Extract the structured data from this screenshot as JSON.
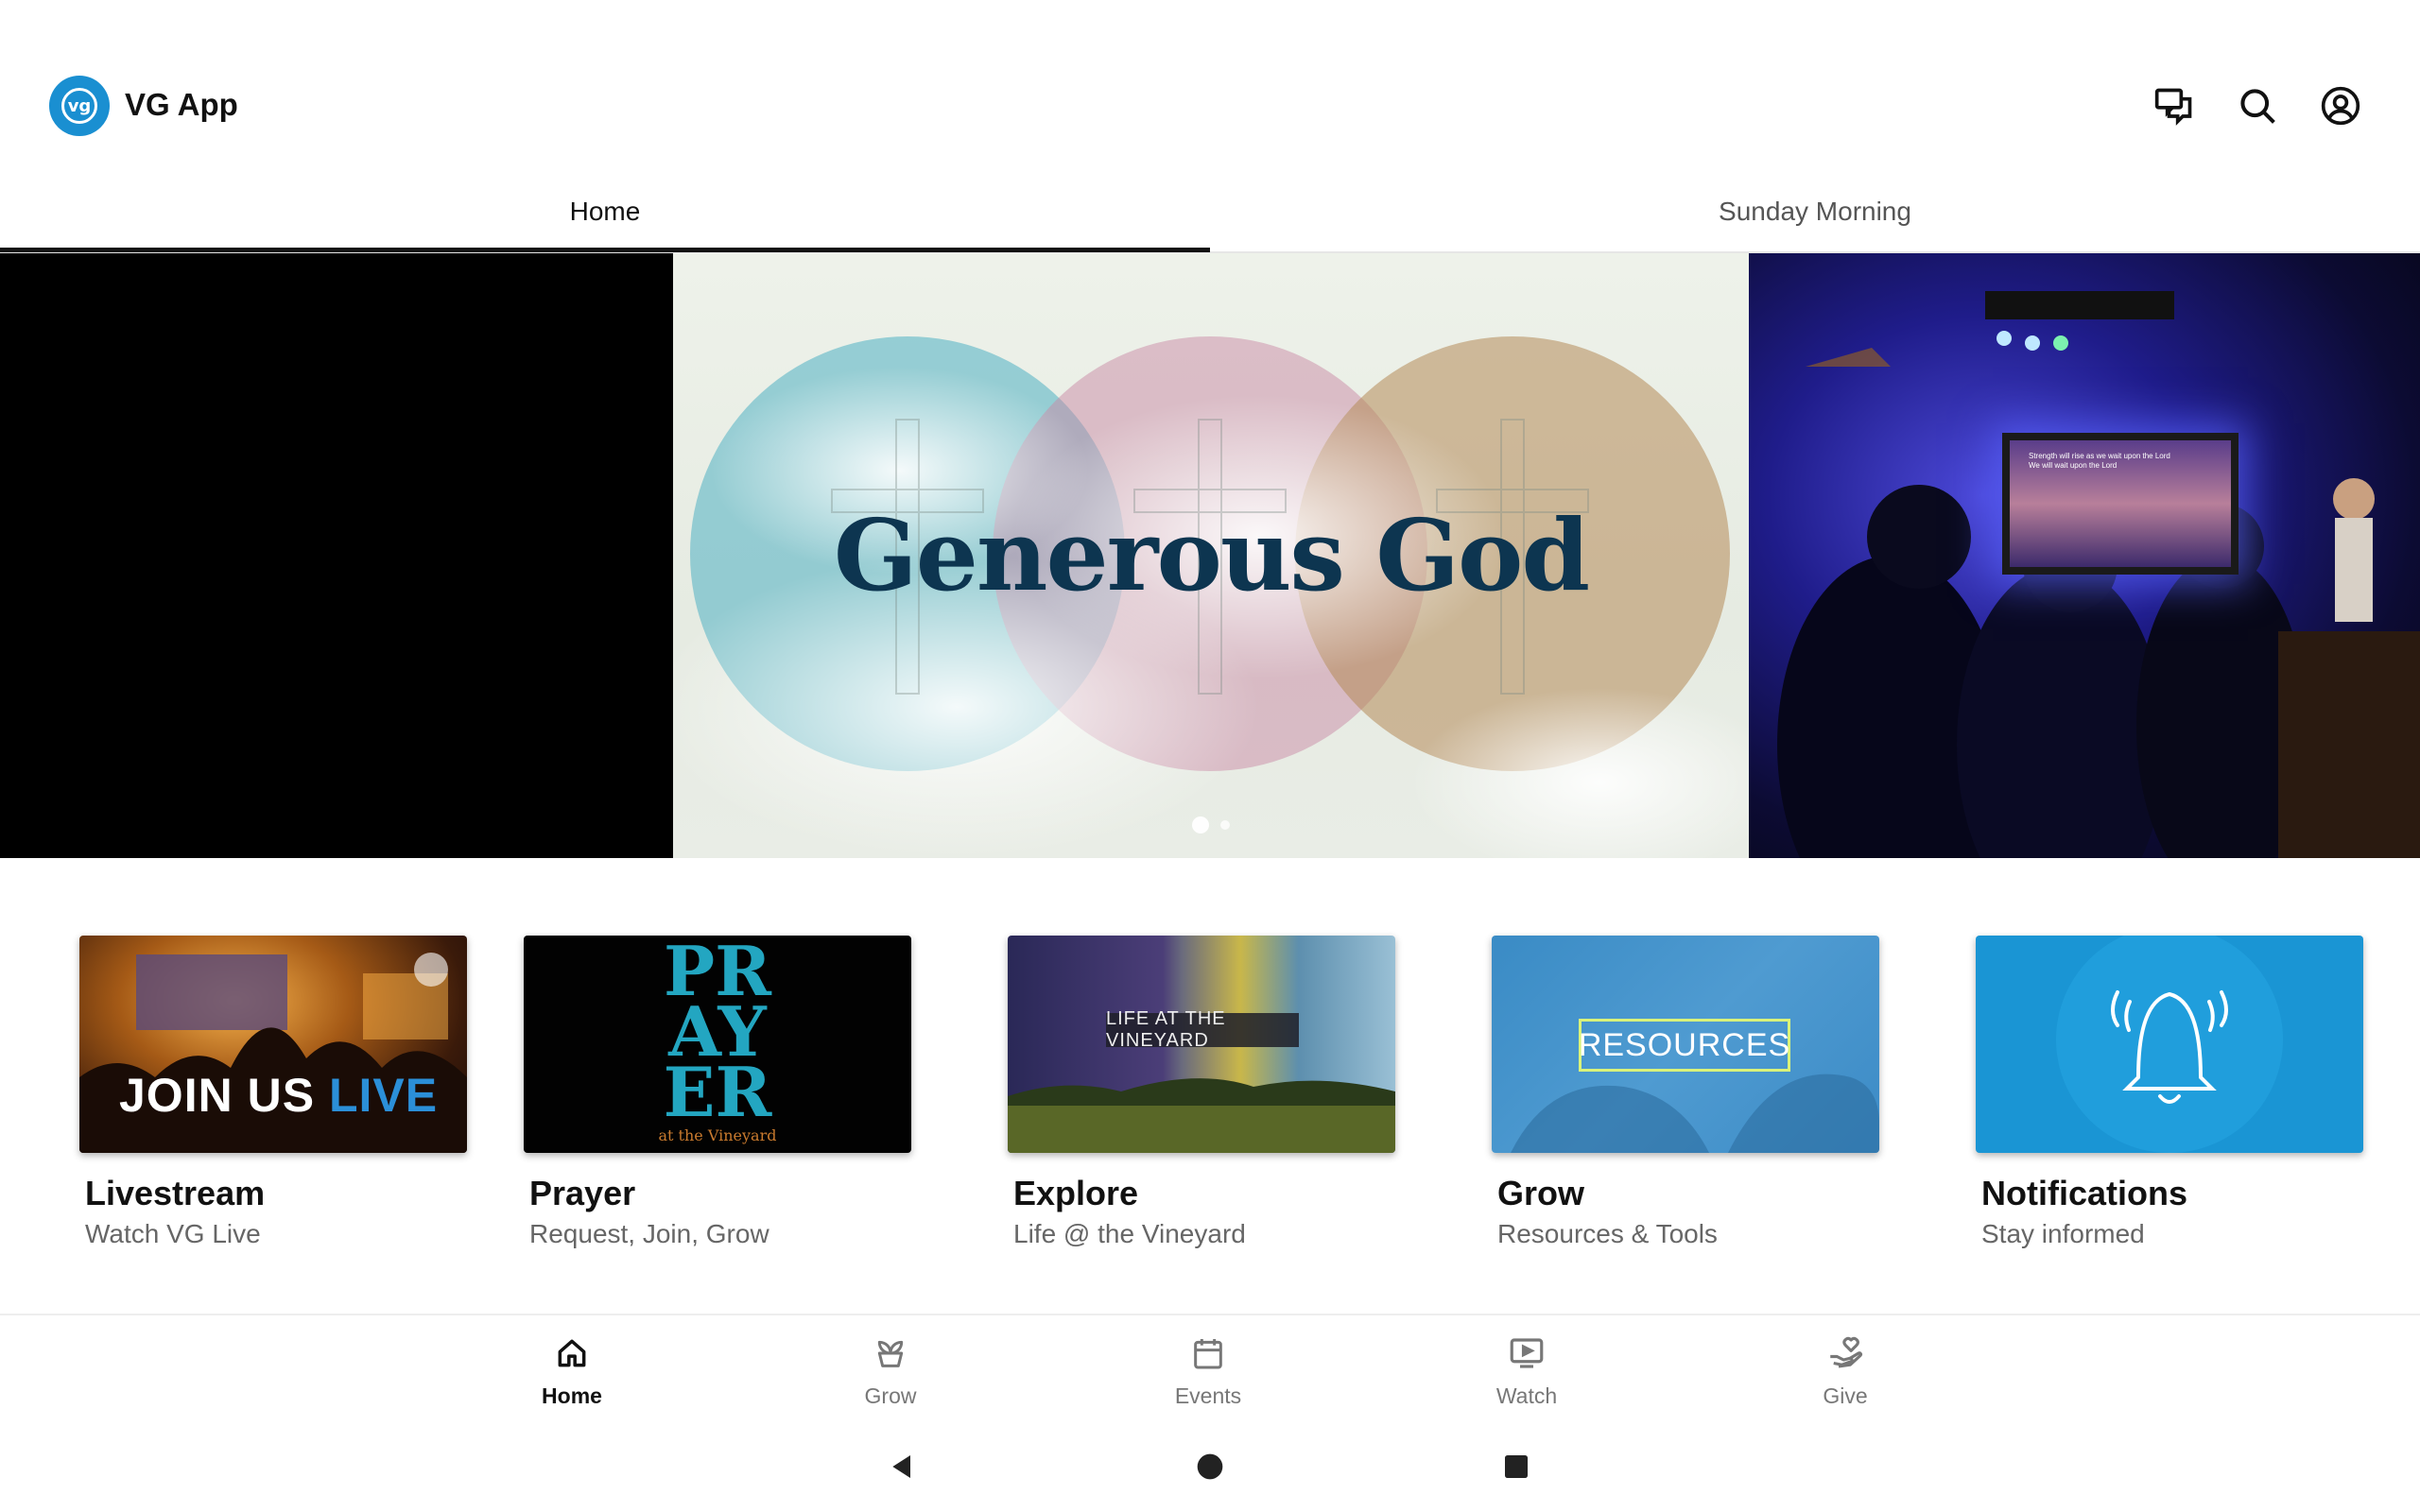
{
  "app": {
    "title": "VG App",
    "logo_text": "vg"
  },
  "topbar_icons": [
    "chat-icon",
    "search-icon",
    "account-icon"
  ],
  "tabs": [
    {
      "label": "Home",
      "active": true
    },
    {
      "label": "Sunday Morning",
      "active": false
    }
  ],
  "carousel": {
    "slide_title": "Generous God",
    "page_count": 2,
    "current_page": 1
  },
  "cards": [
    {
      "title": "Livestream",
      "subtitle": "Watch VG Live",
      "image_text_a": "JOIN US ",
      "image_text_b": "LIVE"
    },
    {
      "title": "Prayer",
      "subtitle": "Request, Join, Grow",
      "image_text": "PRAYER",
      "image_text_line1": "PR",
      "image_text_line2": "AY",
      "image_text_line3": "ER",
      "image_subtext": "at the Vineyard"
    },
    {
      "title": "Explore",
      "subtitle": "Life @ the Vineyard",
      "image_text": "LIFE AT THE VINEYARD"
    },
    {
      "title": "Grow",
      "subtitle": "Resources & Tools",
      "image_text": "RESOURCES"
    },
    {
      "title": "Notifications",
      "subtitle": "Stay informed"
    }
  ],
  "bottom_nav": [
    {
      "label": "Home",
      "icon": "home-icon",
      "active": true
    },
    {
      "label": "Grow",
      "icon": "grow-icon",
      "active": false
    },
    {
      "label": "Events",
      "icon": "calendar-icon",
      "active": false
    },
    {
      "label": "Watch",
      "icon": "watch-icon",
      "active": false
    },
    {
      "label": "Give",
      "icon": "give-icon",
      "active": false
    }
  ],
  "colors": {
    "brand_blue": "#1a8fd1",
    "text_primary": "#111111",
    "text_secondary": "#666666"
  }
}
